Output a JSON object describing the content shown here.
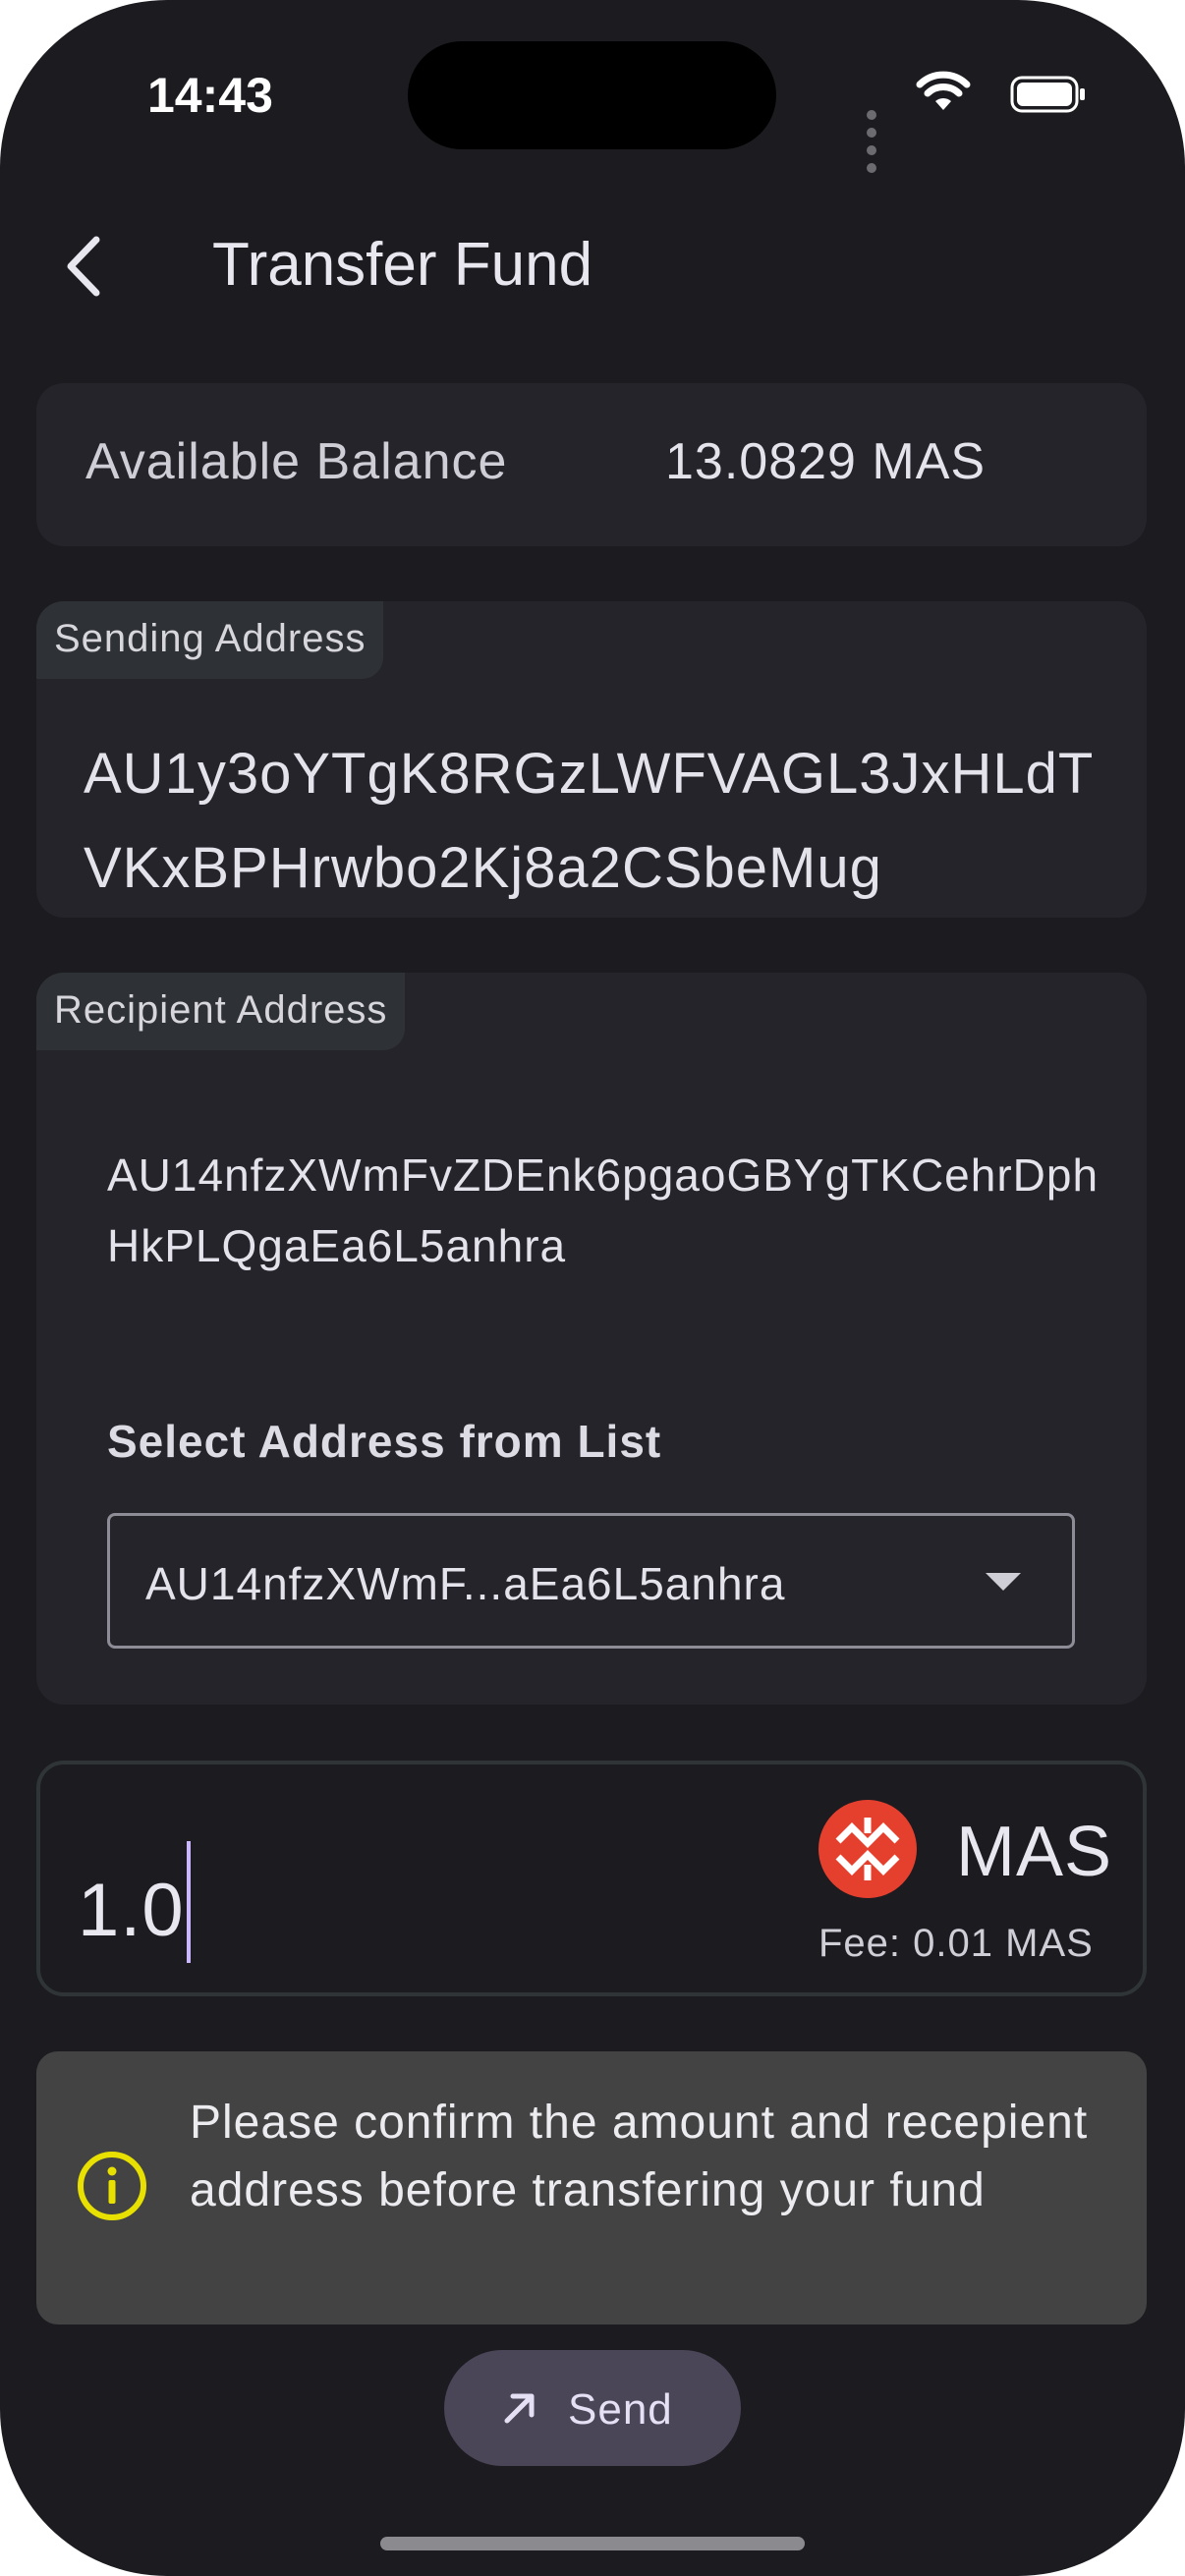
{
  "status_bar": {
    "time": "14:43"
  },
  "header": {
    "title": "Transfer Fund",
    "back_icon": "chevron-left-icon"
  },
  "balance": {
    "label": "Available Balance",
    "value": "13.0829 MAS"
  },
  "sending": {
    "tag": "Sending Address",
    "address": "AU1y3oYTgK8RGzLWFVAGL3JxHLdTVKxBPHrwbo2Kj8a2CSbeMug"
  },
  "recipient": {
    "tag": "Recipient Address",
    "address": "AU14nfzXWmFvZDEnk6pgaoGBYgTKCehrDphHkPLQgaEa6L5anhra",
    "select_label": "Select Address from List",
    "dropdown_value": "AU14nfzXWmF...aEa6L5anhra"
  },
  "amount": {
    "value": "1.0",
    "currency": "MAS",
    "fee": "Fee: 0.01 MAS",
    "logo_icon": "massa-logo-icon"
  },
  "notice": {
    "text": "Please confirm the amount and recepient address before transfering your fund",
    "icon": "info-icon"
  },
  "send_button": {
    "label": "Send",
    "icon": "arrow-up-right-icon"
  },
  "colors": {
    "background": "#1c1b20",
    "card": "#25242a",
    "tag": "#2e3236",
    "notice": "#434343",
    "button": "#4a4557",
    "accent_caret": "#c9b8ff",
    "info_icon": "#e8e000",
    "logo": "#e5402e"
  }
}
